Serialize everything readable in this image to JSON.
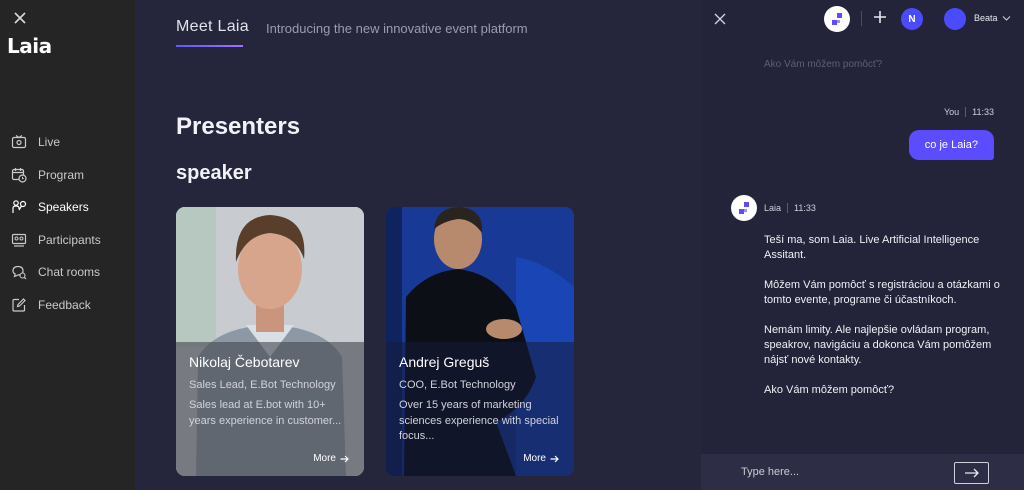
{
  "sidebar": {
    "logo": "Laia",
    "items": [
      {
        "label": "Live",
        "icon": "live-tv-icon"
      },
      {
        "label": "Program",
        "icon": "calendar-clock-icon"
      },
      {
        "label": "Speakers",
        "icon": "speakers-icon"
      },
      {
        "label": "Participants",
        "icon": "participants-icon"
      },
      {
        "label": "Chat rooms",
        "icon": "chat-rooms-icon"
      },
      {
        "label": "Feedback",
        "icon": "feedback-edit-icon"
      }
    ],
    "active": "Speakers"
  },
  "main": {
    "header": {
      "title": "Meet Laia",
      "subtitle": "Introducing the new innovative event platform"
    },
    "section_title": "Presenters",
    "group_title": "speaker",
    "cards": [
      {
        "name": "Nikolaj Čebotarev",
        "role": "Sales Lead, E.Bot Technology",
        "description": "Sales lead at E.bot with 10+ years experience in customer...",
        "more": "More"
      },
      {
        "name": "Andrej Greguš",
        "role": "COO, E.Bot Technology",
        "description": "Over 15 years of marketing sciences experience with special focus...",
        "more": "More"
      }
    ]
  },
  "chat": {
    "header": {
      "avatar_initial": "N",
      "user_name": "Beata"
    },
    "faded_previous": "Ako Vám môžem pomôcť?",
    "messages": [
      {
        "sender": "You",
        "time": "11:33",
        "text": "co je Laia?"
      },
      {
        "sender": "Laia",
        "time": "11:33",
        "paragraphs": [
          "Teší ma, som Laia. Live Artificial Intelligence Assitant.",
          "Môžem Vám pomôcť s registráciou a otázkami o tomto evente, programe či účastníkoch.",
          "Nemám limity. Ale najlepšie ovládam program, speakrov, navigáciu a dokonca Vám pomôžem nájsť nové kontakty.",
          "Ako Vám môžem pomôcť?"
        ]
      }
    ],
    "input": {
      "placeholder": "Type here..."
    }
  },
  "colors": {
    "accent": "#5b4cff",
    "avatar": "#4a4aff",
    "sidebar_bg": "#252526",
    "main_bg": "#25263c"
  }
}
